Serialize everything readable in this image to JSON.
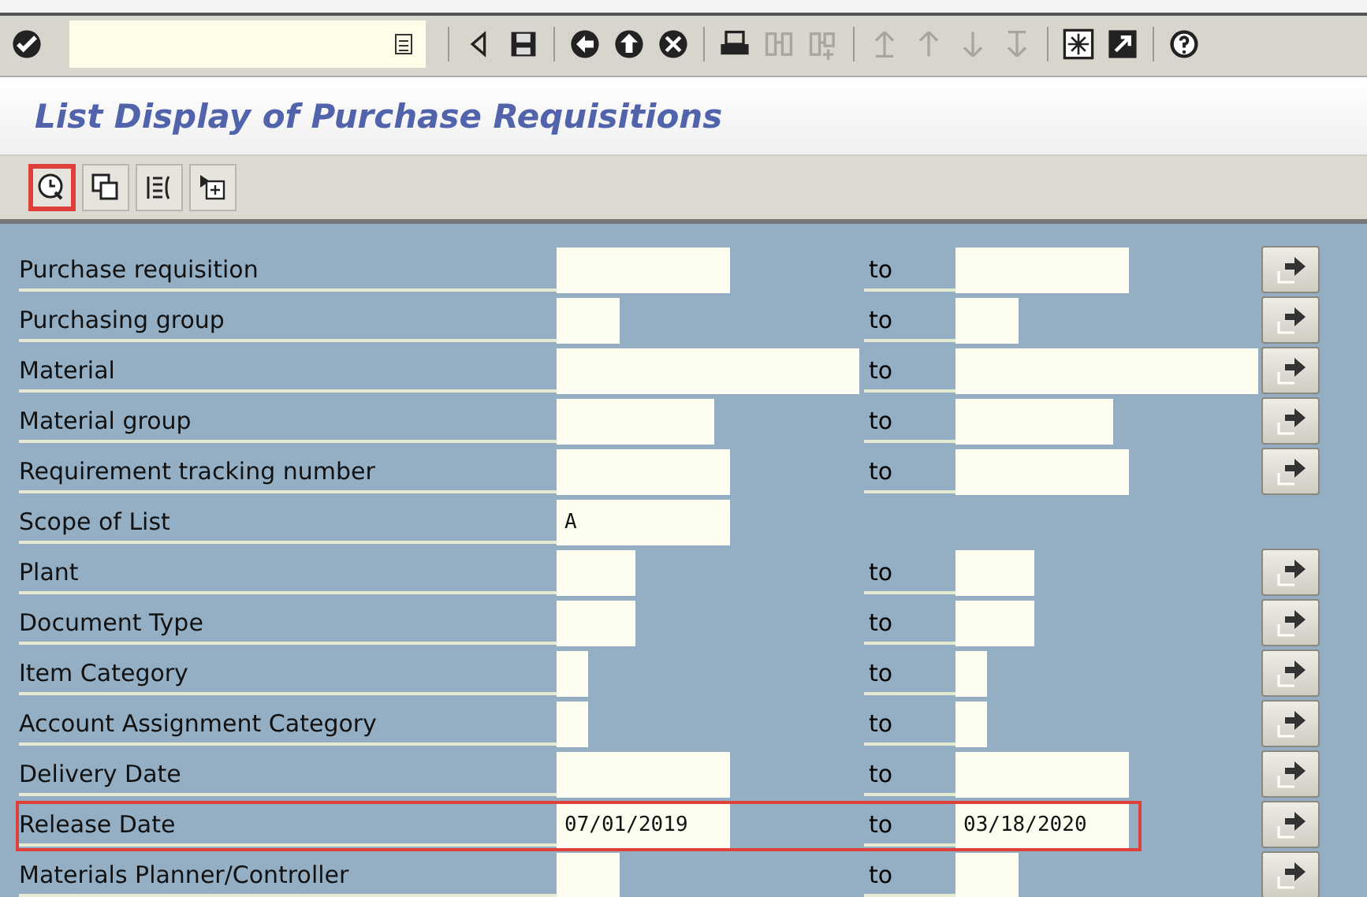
{
  "system_toolbar": [
    {
      "kind": "enter",
      "disabled": false
    },
    {
      "kind": "command_field"
    },
    {
      "kind": "separator"
    },
    {
      "kind": "triangle",
      "disabled": false
    },
    {
      "kind": "save",
      "disabled": false
    },
    {
      "kind": "separator"
    },
    {
      "kind": "back",
      "disabled": false
    },
    {
      "kind": "exit",
      "disabled": false
    },
    {
      "kind": "cancel",
      "disabled": false
    },
    {
      "kind": "separator"
    },
    {
      "kind": "print",
      "disabled": false
    },
    {
      "kind": "find",
      "disabled": true
    },
    {
      "kind": "find_next",
      "disabled": true
    },
    {
      "kind": "separator"
    },
    {
      "kind": "first_page",
      "disabled": true
    },
    {
      "kind": "prev_page",
      "disabled": true
    },
    {
      "kind": "next_page",
      "disabled": true
    },
    {
      "kind": "last_page",
      "disabled": true
    },
    {
      "kind": "separator"
    },
    {
      "kind": "new_session",
      "disabled": false
    },
    {
      "kind": "shortcut",
      "disabled": false
    },
    {
      "kind": "separator"
    },
    {
      "kind": "help",
      "disabled": false
    }
  ],
  "title": "List Display of Purchase Requisitions",
  "app_toolbar": [
    {
      "kind": "execute",
      "highlighted": true
    },
    {
      "kind": "copy",
      "highlighted": false
    },
    {
      "kind": "columns",
      "highlighted": false
    },
    {
      "kind": "expand",
      "highlighted": false
    }
  ],
  "rows": [
    {
      "label": "Purchase requisition",
      "kind": "range",
      "to_label": "to",
      "highlighted": false
    },
    {
      "label": "Purchasing group",
      "kind": "range",
      "to_label": "to",
      "highlighted": false
    },
    {
      "label": "Material",
      "kind": "range",
      "to_label": "to",
      "highlighted": false
    },
    {
      "label": "Material group",
      "kind": "range",
      "to_label": "to",
      "highlighted": false
    },
    {
      "label": "Requirement tracking number",
      "kind": "range",
      "to_label": "to",
      "highlighted": false
    },
    {
      "label": "Scope of List",
      "kind": "single",
      "value": "A",
      "highlighted": false
    },
    {
      "label": "Plant",
      "kind": "range",
      "to_label": "to",
      "highlighted": false
    },
    {
      "label": "Document Type",
      "kind": "range",
      "to_label": "to",
      "highlighted": false
    },
    {
      "label": "Item Category",
      "kind": "range",
      "to_label": "to",
      "highlighted": false
    },
    {
      "label": "Account Assignment Category",
      "kind": "range",
      "to_label": "to",
      "highlighted": false
    },
    {
      "label": "Delivery Date",
      "kind": "range",
      "to_label": "to",
      "highlighted": false
    },
    {
      "label": "Release Date",
      "kind": "range",
      "value": "07/01/2019",
      "to_label": "to",
      "to_value": "03/18/2020",
      "highlighted": true
    },
    {
      "label": "Materials Planner/Controller",
      "kind": "range",
      "to_label": "to",
      "highlighted": false
    }
  ]
}
